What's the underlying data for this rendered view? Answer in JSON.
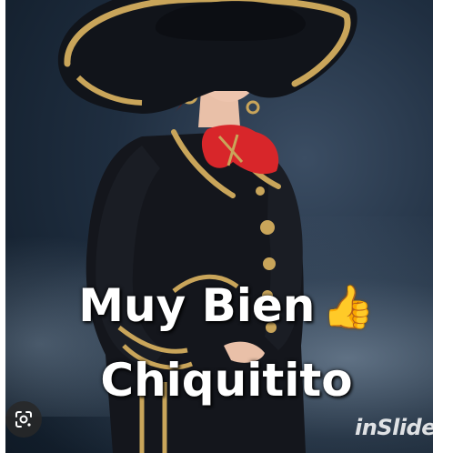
{
  "caption": {
    "line1": "Muy Bien",
    "line1_emoji": "👍",
    "line2": "Chiquitito"
  },
  "watermark": {
    "text": "inSlide"
  },
  "icons": {
    "lens": "google-lens-icon",
    "thumbs": "thumbs-up-emoji"
  },
  "colors": {
    "background": "#1f2e40",
    "jacket": "#14161c",
    "embroidery": "#c9a55a",
    "bow": "#d8262a",
    "caption_text": "#ffffff"
  }
}
